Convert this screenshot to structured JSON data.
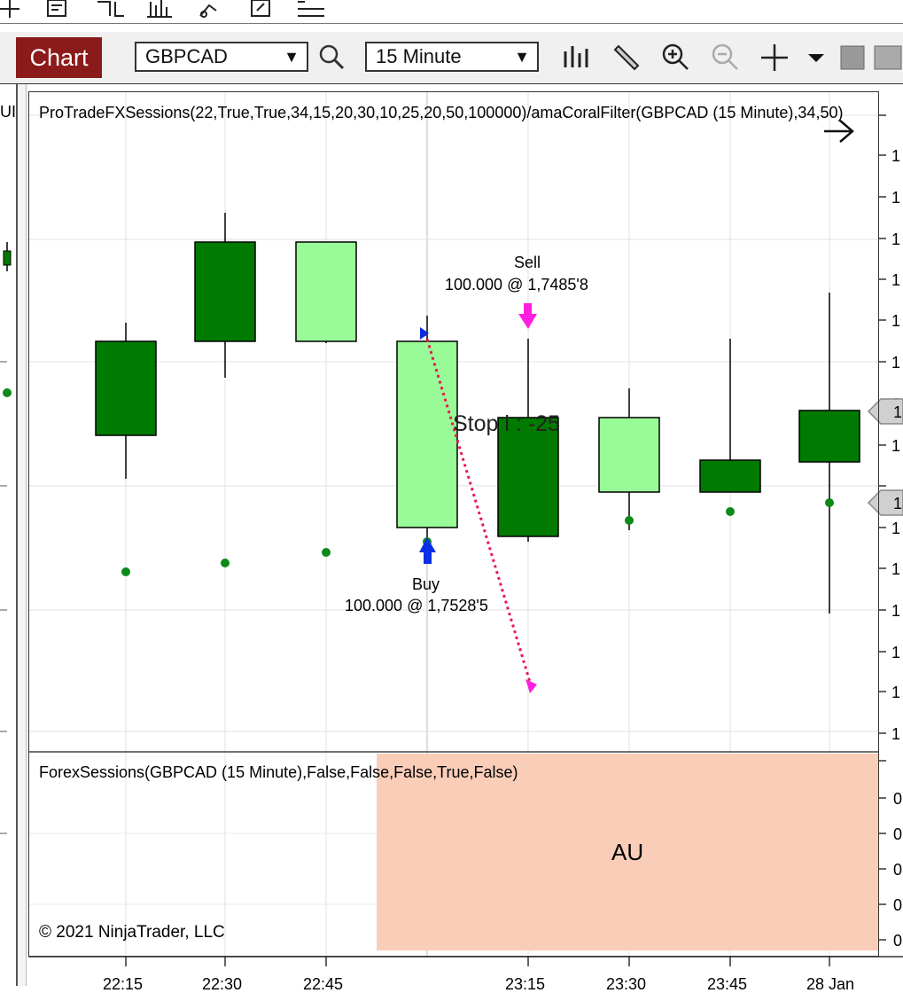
{
  "window": {
    "chart_tab_label": "Chart",
    "instrument": "GBPCAD",
    "interval": "15 Minute"
  },
  "panels": {
    "price": {
      "indicator_title": "ProTradeFXSessions(22,True,True,34,15,20,30,10,25,20,50,100000)/amaCoralFilter(GBPCAD (15 Minute),34,50)",
      "left_cut_label": "UI"
    },
    "sessions": {
      "title": "ForexSessions(GBPCAD (15 Minute),False,False,False,True,False)",
      "session_label": "AU",
      "session_color": "#f9cdb8"
    }
  },
  "trades": {
    "sell_label": "Sell",
    "sell_detail": "100.000 @ 1,7485'8",
    "buy_label": "Buy",
    "buy_detail": "100.000 @ 1,7528'5",
    "stop_label_visible": "Stop l    : -25"
  },
  "copyright": "© 2021 NinjaTrader, LLC",
  "colors": {
    "up_dark": "#007a00",
    "up_light": "#98fb98",
    "sell_marker": "#ff1fe0",
    "buy_marker": "#0b2ee6",
    "exit_line": "#e8174f",
    "coral_dot": "#0b8a18"
  },
  "x_axis": {
    "labels": [
      "22:15",
      "22:30",
      "22:45",
      "23:15",
      "23:30",
      "23:45",
      "28 Jan"
    ]
  },
  "y_axis": {
    "right_tick_labels": [
      "1",
      "1",
      "1",
      "1",
      "1",
      "1",
      "1",
      "1",
      "1",
      "1",
      "1",
      "1",
      "1",
      "1"
    ],
    "lower_tick_labels": [
      "0",
      "0",
      "0",
      "0",
      "0"
    ],
    "price_tag_labels": [
      "1",
      "1"
    ]
  }
}
